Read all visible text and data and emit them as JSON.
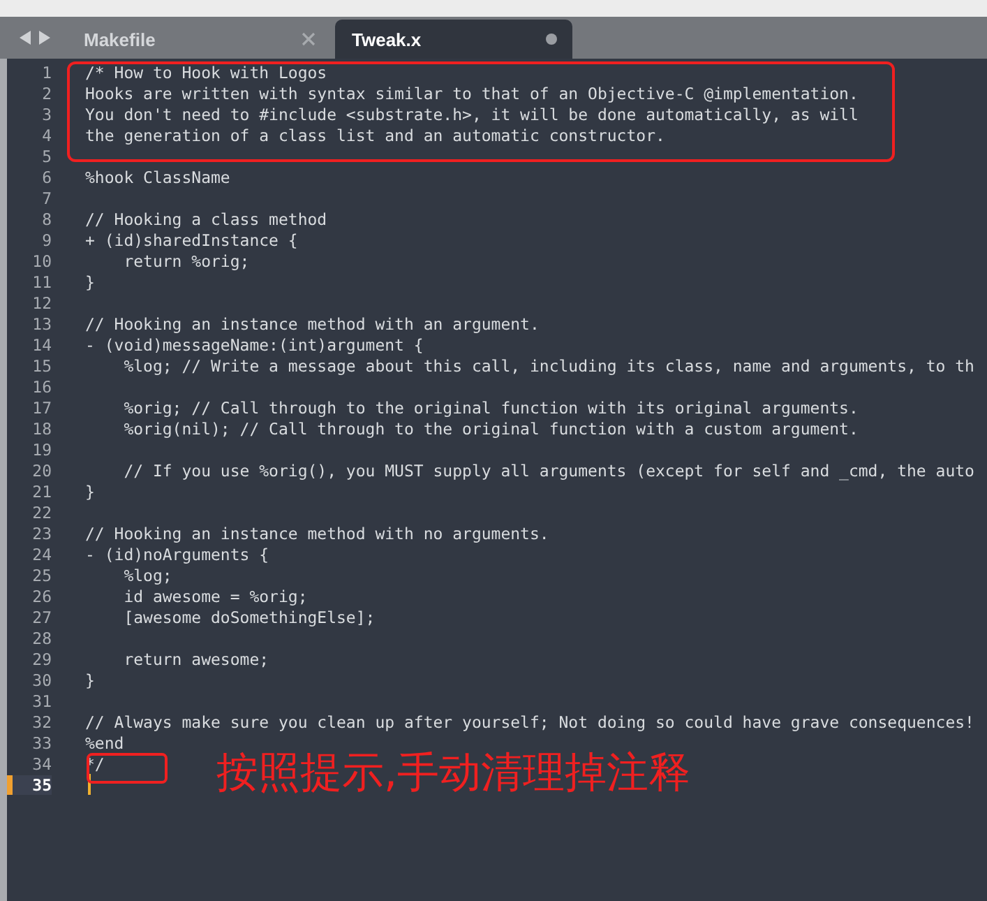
{
  "tabs": [
    {
      "label": "Makefile",
      "selected": false,
      "modified": false
    },
    {
      "label": "Tweak.x",
      "selected": true,
      "modified": true
    }
  ],
  "lines": [
    {
      "number": "1",
      "text": "/* How to Hook with Logos",
      "current": false
    },
    {
      "number": "2",
      "text": "Hooks are written with syntax similar to that of an Objective-C @implementation.",
      "current": false
    },
    {
      "number": "3",
      "text": "You don't need to #include <substrate.h>, it will be done automatically, as will",
      "current": false
    },
    {
      "number": "4",
      "text": "the generation of a class list and an automatic constructor.",
      "current": false
    },
    {
      "number": "5",
      "current": false
    },
    {
      "number": "6",
      "text": "%hook ClassName",
      "current": false
    },
    {
      "number": "7",
      "current": false
    },
    {
      "number": "8",
      "text": "// Hooking a class method",
      "current": false
    },
    {
      "number": "9",
      "text": "+ (id)sharedInstance {",
      "current": false
    },
    {
      "number": "10",
      "text": "    return %orig;",
      "current": false
    },
    {
      "number": "11",
      "text": "}",
      "current": false
    },
    {
      "number": "12",
      "current": false
    },
    {
      "number": "13",
      "text": "// Hooking an instance method with an argument.",
      "current": false
    },
    {
      "number": "14",
      "text": "- (void)messageName:(int)argument {",
      "current": false
    },
    {
      "number": "15",
      "text": "    %log; // Write a message about this call, including its class, name and arguments, to th",
      "current": false
    },
    {
      "number": "16",
      "current": false
    },
    {
      "number": "17",
      "text": "    %orig; // Call through to the original function with its original arguments.",
      "current": false
    },
    {
      "number": "18",
      "text": "    %orig(nil); // Call through to the original function with a custom argument.",
      "current": false
    },
    {
      "number": "19",
      "current": false
    },
    {
      "number": "20",
      "text": "    // If you use %orig(), you MUST supply all arguments (except for self and _cmd, the auto",
      "current": false
    },
    {
      "number": "21",
      "text": "}",
      "current": false
    },
    {
      "number": "22",
      "current": false
    },
    {
      "number": "23",
      "text": "// Hooking an instance method with no arguments.",
      "current": false
    },
    {
      "number": "24",
      "text": "- (id)noArguments {",
      "current": false
    },
    {
      "number": "25",
      "text": "    %log;",
      "current": false
    },
    {
      "number": "26",
      "text": "    id awesome = %orig;",
      "current": false
    },
    {
      "number": "27",
      "text": "    [awesome doSomethingElse];",
      "current": false
    },
    {
      "number": "28",
      "current": false
    },
    {
      "number": "29",
      "text": "    return awesome;",
      "current": false
    },
    {
      "number": "30",
      "text": "}",
      "current": false
    },
    {
      "number": "31",
      "current": false
    },
    {
      "number": "32",
      "text": "// Always make sure you clean up after yourself; Not doing so could have grave consequences!",
      "current": false
    },
    {
      "number": "33",
      "text": "%end",
      "current": false
    },
    {
      "number": "34",
      "text": "*/",
      "current": false
    },
    {
      "number": "35",
      "current": true
    }
  ],
  "annotation": {
    "note": "按照提示,手动清理掉注释"
  }
}
